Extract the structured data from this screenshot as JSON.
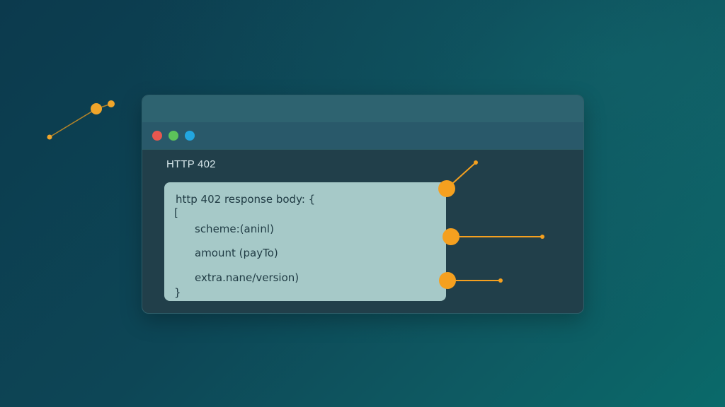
{
  "window": {
    "heading": "HTTP 402",
    "controls": [
      {
        "name": "close",
        "color": "#e8574f"
      },
      {
        "name": "minimize",
        "color": "#5cc35a"
      },
      {
        "name": "maximize",
        "color": "#22a6df"
      }
    ]
  },
  "code": {
    "line1": "http 402 response body: {",
    "line2": "[",
    "line3": "scheme:(aninl)",
    "line4": "amount (payTo)",
    "line5": "extra.nane/version)",
    "line6": "}"
  },
  "colors": {
    "accent": "#f5a01f",
    "code_panel": "#a6c9c8",
    "window_bg": "#213f4a"
  }
}
